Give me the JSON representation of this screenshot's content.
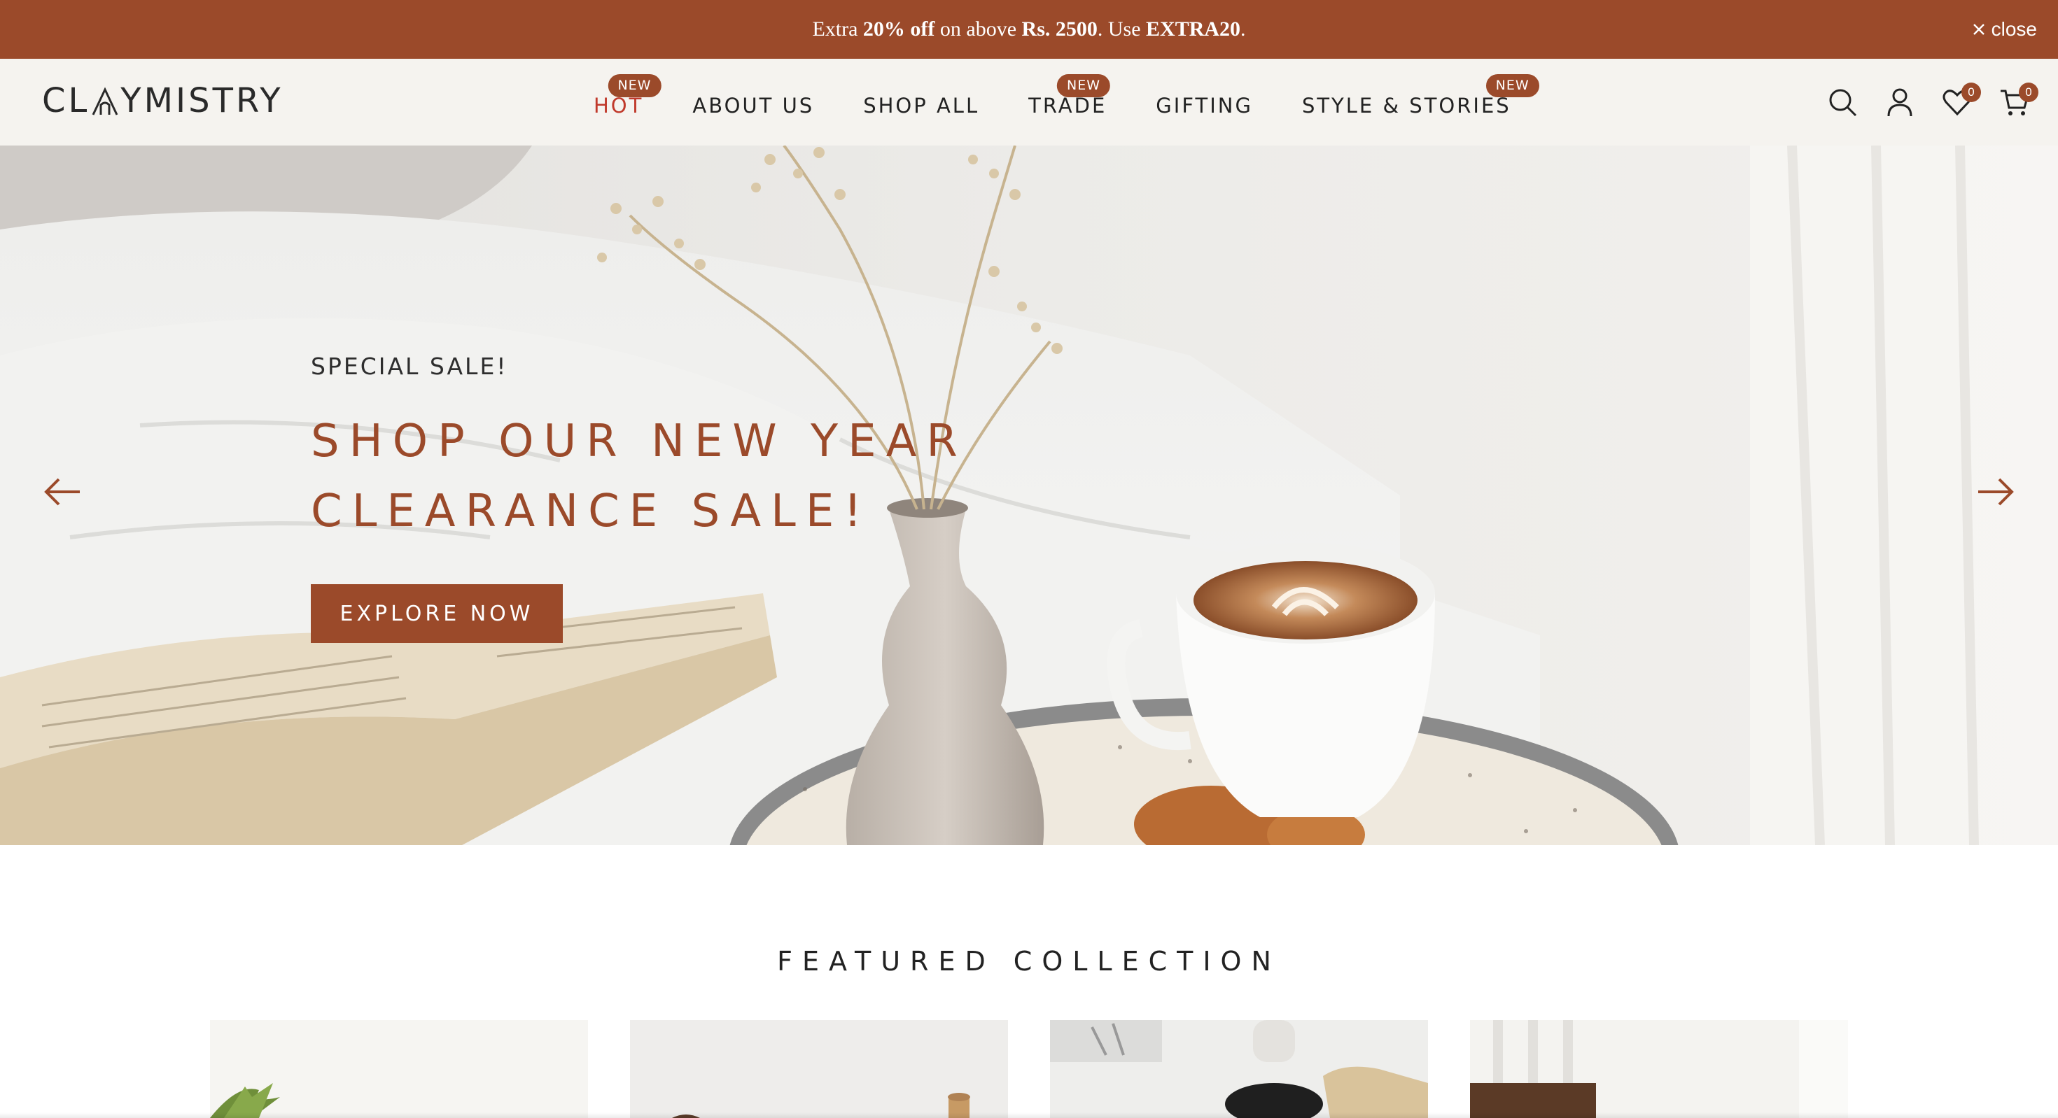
{
  "announcement": {
    "prefix": "Extra ",
    "highlight_percent": "20% off",
    "middle": " on above ",
    "highlight_amount": "Rs. 2500",
    "use_text": ". Use ",
    "code": "EXTRA20",
    "suffix": ".",
    "close_label": "close"
  },
  "brand": {
    "logo_text_left": "CL",
    "logo_text_right": "YMISTRY",
    "accent_color": "#9b4a2a"
  },
  "nav": {
    "items": [
      {
        "label": "HOT",
        "badge": "NEW"
      },
      {
        "label": "ABOUT US"
      },
      {
        "label": "SHOP ALL"
      },
      {
        "label": "TRADE",
        "badge": "NEW"
      },
      {
        "label": "GIFTING"
      },
      {
        "label": "STYLE & STORIES",
        "badge": "NEW"
      }
    ]
  },
  "header_icons": {
    "search": "search-icon",
    "account": "user-icon",
    "wishlist": "heart-icon",
    "wishlist_count": "0",
    "cart": "cart-icon",
    "cart_count": "0"
  },
  "hero": {
    "eyebrow": "SPECIAL SALE!",
    "headline_line1": "SHOP OUR NEW YEAR",
    "headline_line2": "CLEARANCE SALE!",
    "cta_label": "EXPLORE NOW",
    "prev_icon": "arrow-left-icon",
    "next_icon": "arrow-right-icon"
  },
  "featured": {
    "title": "FEATURED COLLECTION"
  }
}
